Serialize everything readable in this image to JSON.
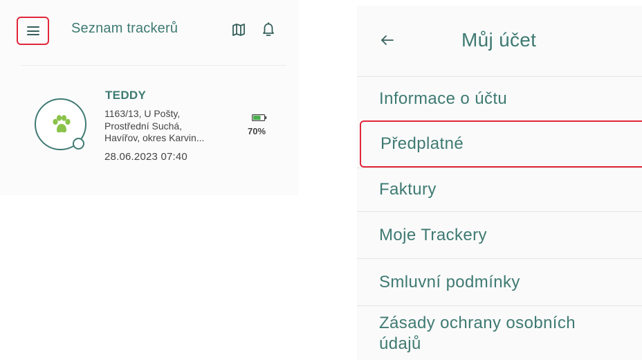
{
  "left_screen": {
    "header": {
      "title": "Seznam trackerů",
      "menu_icon": "hamburger-menu-icon",
      "map_icon": "map-icon",
      "bell_icon": "bell-icon",
      "highlight_color": "#e0273a"
    },
    "tracker": {
      "name": "TEDDY",
      "address_lines": [
        "1163/13, U Pošty,",
        "Prostřední Suchá,",
        "Havířov, okres Karvin..."
      ],
      "timestamp": "28.06.2023 07:40",
      "battery": "70%",
      "battery_level": 0.7,
      "avatar_icon": "paw-icon",
      "paw_color": "#8bc34a"
    }
  },
  "right_screen": {
    "title": "Můj účet",
    "back_icon": "back-arrow-icon",
    "menu_items": [
      {
        "label": "Informace o účtu"
      },
      {
        "label": "Předplatné",
        "highlighted": true
      },
      {
        "label": "Faktury"
      },
      {
        "label": "Moje Trackery"
      },
      {
        "label": "Smluvní podmínky"
      },
      {
        "label_lines": [
          "Zásady ochrany osobních",
          "údajů"
        ]
      }
    ]
  },
  "colors": {
    "accent": "#3e7a72",
    "highlight_border": "#e0273a",
    "text_dark": "#444444"
  }
}
